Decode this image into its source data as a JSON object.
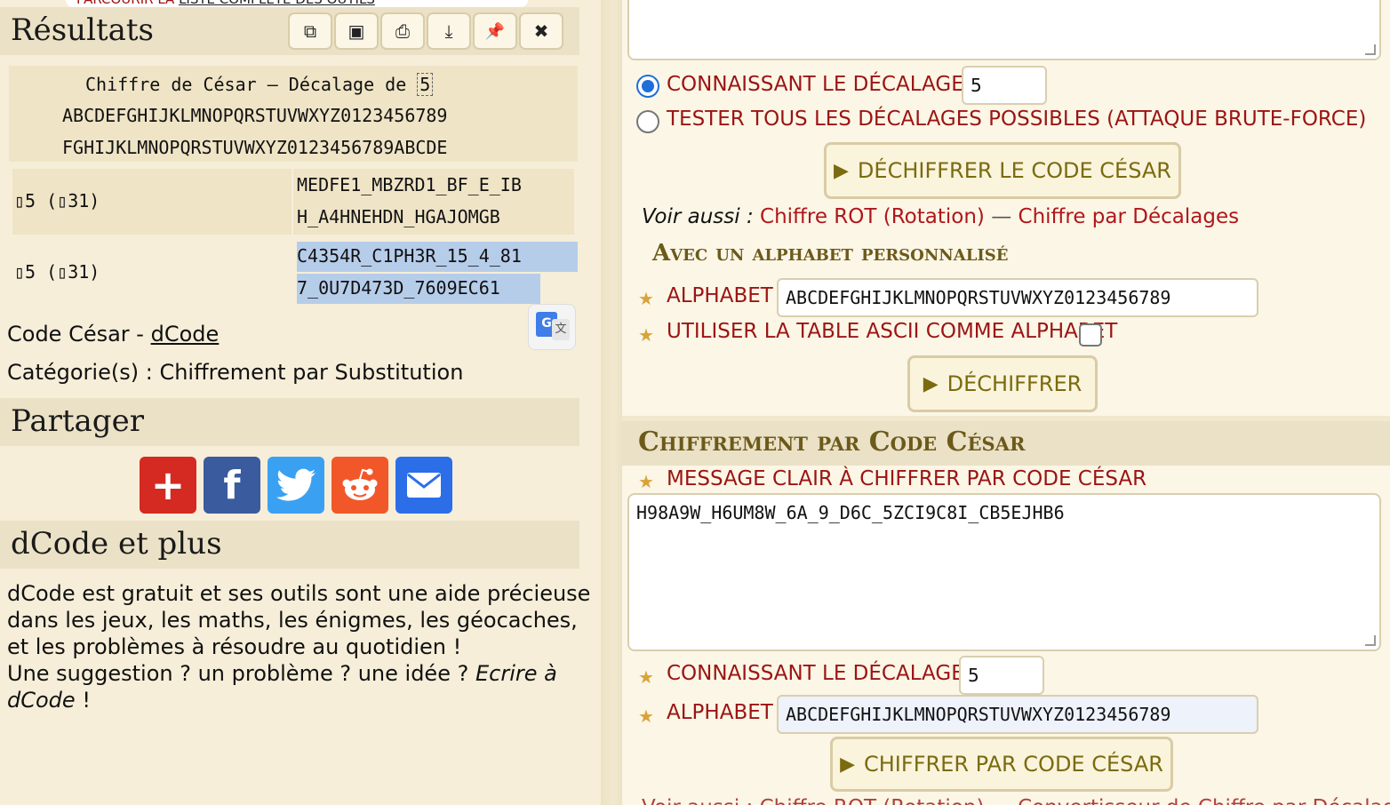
{
  "left": {
    "top_strip": {
      "prefix": "PARCOURIR LA ",
      "link": "LISTE COMPLÈTE DES OUTILS"
    },
    "results": {
      "title": "Résultats",
      "toolbar": [
        {
          "name": "copy",
          "glyph": "⧉"
        },
        {
          "name": "screenshot",
          "glyph": "▣"
        },
        {
          "name": "print",
          "glyph": "⎙"
        },
        {
          "name": "download",
          "glyph": "⤓"
        },
        {
          "name": "pin",
          "glyph": "📌"
        },
        {
          "name": "close",
          "glyph": "✖"
        }
      ],
      "header_prefix": "Chiffre de César – Décalage de",
      "header_shift": "5",
      "alphabet_plain": "ABCDEFGHIJKLMNOPQRSTUVWXYZ0123456789",
      "alphabet_shifted": "FGHIJKLMNOPQRSTUVWXYZ0123456789ABCDE",
      "rows": [
        {
          "label": "▯5 (▯31)",
          "line1": "MEDFE1_MBZRD1_BF_E_IB",
          "line2": "H_A4HNEHDN_HGAJOMGB"
        },
        {
          "label": "▯5 (▯31)",
          "line1": "C4354R_C1PH3R_15_4_81",
          "line2": "7_0U7D473D_7609EC61"
        }
      ]
    },
    "meta": {
      "tool_name": "Code César",
      "tool_sep": " - ",
      "tool_link": "dCode",
      "category_label": "Catégorie(s) : ",
      "category_value": "Chiffrement par Substitution"
    },
    "share": {
      "title": "Partager",
      "buttons": [
        {
          "name": "addthis",
          "color": "#d42a22",
          "glyph": "+"
        },
        {
          "name": "facebook",
          "color": "#3a5b9e",
          "glyph": "f"
        },
        {
          "name": "twitter",
          "color": "#3aa1f2",
          "glyph": "🐦"
        },
        {
          "name": "reddit",
          "color": "#f2572a",
          "glyph": "●"
        },
        {
          "name": "email",
          "color": "#2b6ee8",
          "glyph": "✉"
        }
      ]
    },
    "more": {
      "title": "dCode et plus",
      "para1_l1": "dCode est gratuit et ses outils sont une aide précieuse",
      "para1_l2": "dans les jeux, les maths, les énigmes, les géocaches,",
      "para1_l3": "et les problèmes à résoudre au quotidien !",
      "para2_a": "Une suggestion ? un problème ? une idée ? ",
      "para2_link1": "Ecrire à",
      "para2_link2": "dCode",
      "para2_b": " !"
    }
  },
  "right": {
    "decrypt": {
      "radio_known_label": "CONNAISSANT LE DÉCALAGE :",
      "shift_value": "5",
      "radio_brute_label": "TESTER TOUS LES DÉCALAGES POSSIBLES (ATTAQUE BRUTE-FORCE)",
      "decrypt_button": "DÉCHIFFRER LE CODE CÉSAR",
      "see_also_label": "Voir aussi :",
      "see_also_link1": "Chiffre ROT (Rotation)",
      "see_also_sep": " — ",
      "see_also_link2": "Chiffre par Décalages",
      "custom_title": "Avec un alphabet personnalisé",
      "alphabet_label": "ALPHABET",
      "alphabet_value": "ABCDEFGHIJKLMNOPQRSTUVWXYZ0123456789",
      "ascii_label": "UTILISER LA TABLE ASCII COMME ALPHABET",
      "decrypt2_button": "DÉCHIFFRER"
    },
    "encrypt": {
      "title": "Chiffrement par Code César",
      "message_label": "MESSAGE CLAIR À CHIFFRER PAR CODE CÉSAR",
      "message_value": "H98A9W_H6UM8W_6A_9_D6C_5ZCI9C8I_CB5EJHB6",
      "shift_label": "CONNAISSANT LE DÉCALAGE :",
      "shift_value": "5",
      "alphabet_label": "ALPHABET",
      "alphabet_value": "ABCDEFGHIJKLMNOPQRSTUVWXYZ0123456789",
      "encrypt_button": "CHIFFRER PAR CODE CÉSAR",
      "bottom_cut": "Voir aussi : Chiffre ROT (Rotation) — Convertisseur de Chiffre par Décalages"
    }
  },
  "colors": {
    "accent_red": "#9b1414",
    "button_text": "#7a6b10",
    "selection": "#b6cdea",
    "panel_bg": "#ebe1c6"
  }
}
